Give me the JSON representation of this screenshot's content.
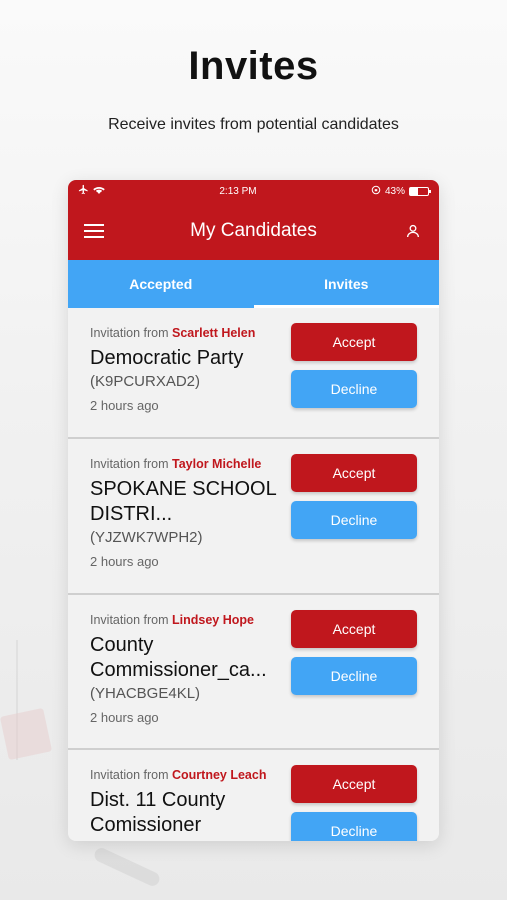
{
  "promo": {
    "title": "Invites",
    "subtitle": "Receive invites from potential candidates"
  },
  "status_bar": {
    "time": "2:13 PM",
    "battery": "43%",
    "battery_level": 0.43,
    "left_icons": [
      "airplane-icon",
      "wifi-icon"
    ],
    "right_icons": [
      "rotation-lock-icon",
      "battery-icon"
    ]
  },
  "header": {
    "title": "My Candidates",
    "menu_icon": "menu-icon",
    "profile_icon": "person-icon"
  },
  "tabs": [
    {
      "label": "Accepted",
      "active": false
    },
    {
      "label": "Invites",
      "active": true
    }
  ],
  "colors": {
    "brand_red": "#c0171d",
    "accent_blue": "#42a5f5"
  },
  "invites": [
    {
      "prefix": "Invitation from",
      "from": "Scarlett Helen",
      "title": "Democratic Party",
      "code": "(K9PCURXAD2)",
      "time": "2 hours ago",
      "accept_label": "Accept",
      "decline_label": "Decline"
    },
    {
      "prefix": "Invitation from",
      "from": "Taylor Michelle",
      "title": "SPOKANE SCHOOL DISTRI...",
      "code": "(YJZWK7WPH2)",
      "time": "2 hours ago",
      "accept_label": "Accept",
      "decline_label": "Decline"
    },
    {
      "prefix": "Invitation from",
      "from": "Lindsey Hope",
      "title": "County Commissioner_ca...",
      "code": "(YHACBGE4KL)",
      "time": "2 hours ago",
      "accept_label": "Accept",
      "decline_label": "Decline"
    },
    {
      "prefix": "Invitation from",
      "from": "Courtney Leach",
      "title": "Dist. 11 County Comissioner",
      "code": "",
      "time": "",
      "accept_label": "Accept",
      "decline_label": "Decline"
    }
  ]
}
